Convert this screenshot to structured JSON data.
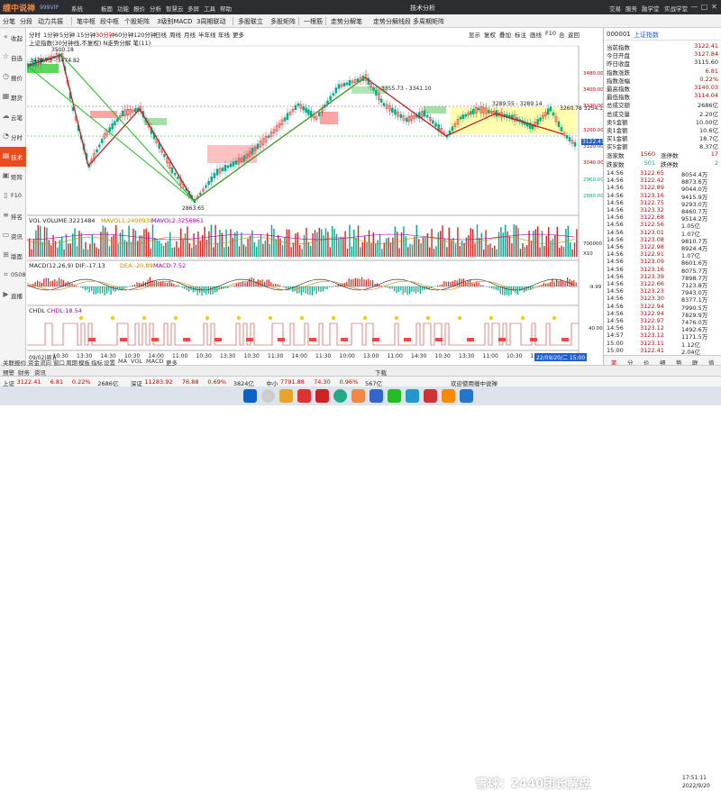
{
  "app": {
    "logo": "缠中说禅",
    "logo_sub": "999VIP",
    "menus": [
      "系统",
      "板面",
      "功能",
      "报价",
      "分析",
      "智慧云",
      "多屏",
      "工具",
      "帮助"
    ],
    "window_title": "技术分析",
    "right_links": [
      "交易",
      "服务",
      "融学堂",
      "实战学堂"
    ],
    "win_buttons": [
      "—",
      "□",
      "✕"
    ]
  },
  "toolbar": {
    "items": [
      "分笔",
      "分段",
      "动力共振",
      "笔中枢",
      "段中枢",
      "个股矩阵",
      "3级别MACD",
      "3周期联动",
      "多股联立",
      "多股矩阵",
      "一根筋",
      "走势分解笔",
      "走势分解线段",
      "多周期矩阵"
    ]
  },
  "sidebar": {
    "items": [
      {
        "label": "收起",
        "icon": "collapse-icon"
      },
      {
        "label": "自选",
        "icon": "star-icon"
      },
      {
        "label": "报价",
        "icon": "quote-icon"
      },
      {
        "label": "期货",
        "icon": "futures-icon"
      },
      {
        "label": "云笔",
        "icon": "cloud-icon"
      },
      {
        "label": "分时",
        "icon": "clock-icon"
      },
      {
        "label": "技术",
        "icon": "candle-icon"
      },
      {
        "label": "矩阵",
        "icon": "grid-icon"
      },
      {
        "label": "F10",
        "icon": "doc-icon"
      },
      {
        "label": "排名",
        "icon": "rank-icon"
      },
      {
        "label": "资讯",
        "icon": "news-icon"
      },
      {
        "label": "版面",
        "icon": "layout-icon"
      },
      {
        "label": "0508",
        "icon": "code-icon"
      },
      {
        "label": "直播",
        "icon": "live-icon"
      }
    ],
    "active_index": 6
  },
  "chart": {
    "periods": [
      "分时",
      "1分钟",
      "5分钟",
      "15分钟",
      "30分钟",
      "60分钟",
      "120分钟",
      "日线",
      "周线",
      "月线",
      "半年线",
      "年线",
      "更多"
    ],
    "active_period": "30分钟",
    "right_tools": [
      "显示",
      "复权",
      "叠加",
      "标注",
      "画线",
      "F10",
      "合",
      "返回"
    ],
    "header": "上证指数(30分钟线,不复权) N走势分解 笔(11)",
    "price_labels": [
      "3500.18",
      "3478.73 - 3474.82",
      "3355.73 - 3341.10",
      "3289.55 - 3289.14",
      "3260.78",
      "3254.1",
      "2863.65"
    ],
    "cur_price_tag": "3122.41",
    "y_ticks": [
      "3480.00",
      "3400.00",
      "3320.00",
      "3200.00",
      "3120.00",
      "3040.00",
      "2960.00",
      "2880.00"
    ],
    "volume_label": "VOL VOLUME:3221484",
    "vol_ma1": "MAVOL1:2400938",
    "vol_ma2": "MAVOL2:3256861",
    "vol_ticks": [
      "700000",
      "X10"
    ],
    "macd_label": "MACD(12,26,9) DIF:-17.13",
    "macd_dea": "DEA:-20.89",
    "macd_val": "MACD:7.52",
    "macd_tick": "-9.99",
    "chdl_label": "CHDL",
    "chdl_val": "CHDL:18.54",
    "chdl_tick": "40.00",
    "time_axis": [
      "09/02|周五",
      "10:30",
      "13:30",
      "14:30",
      "10:30",
      "14:00",
      "11:00",
      "10:30",
      "13:30",
      "10:30",
      "11:30",
      "14:00",
      "11:30",
      "10:00",
      "13:00",
      "11:00",
      "14:30",
      "10:30",
      "13:30",
      "11:00",
      "10:30",
      "13:30",
      "14:00"
    ],
    "time_cursor": "22/09/20/二 15:00"
  },
  "quote": {
    "code": "000001",
    "name": "上证指数",
    "rows": [
      {
        "label": "当前指数",
        "value": "3122.41",
        "color": "#c00"
      },
      {
        "label": "今日开盘",
        "value": "3127.84",
        "color": "#c00"
      },
      {
        "label": "昨日收盘",
        "value": "3115.60",
        "color": "#222"
      },
      {
        "label": "指数涨跌",
        "value": "6.81",
        "color": "#c00"
      },
      {
        "label": "指数涨幅",
        "value": "0.22%",
        "color": "#c00"
      },
      {
        "label": "最高指数",
        "value": "3140.03",
        "color": "#c00"
      },
      {
        "label": "最低指数",
        "value": "3114.04",
        "color": "#c00"
      },
      {
        "label": "总成交额",
        "value": "2686亿",
        "color": "#222"
      },
      {
        "label": "总成交量",
        "value": "2.20亿",
        "color": "#222"
      },
      {
        "label": "卖5金额",
        "value": "10.00亿",
        "color": "#222"
      },
      {
        "label": "卖1金额",
        "value": "10.6亿",
        "color": "#222"
      },
      {
        "label": "买1金额",
        "value": "18.7亿",
        "color": "#222"
      },
      {
        "label": "买5金额",
        "value": "8.37亿",
        "color": "#222"
      }
    ],
    "updown": {
      "up_label": "涨家数",
      "up": "1560",
      "flat_label": "涨停数",
      "flat": "17",
      "down_label": "跌家数",
      "down": "501",
      "limitdown_label": "跌停数",
      "limitdown": "2"
    }
  },
  "ticks": [
    [
      "14:56",
      "3122.65",
      "8054.4万",
      ""
    ],
    [
      "14:56",
      "3122.42",
      "8873.6万",
      ""
    ],
    [
      "14:56",
      "3122.89",
      "9044.0万",
      ""
    ],
    [
      "14:56",
      "3123.16",
      "9415.9万",
      ""
    ],
    [
      "14:56",
      "3122.75",
      "9293.0万",
      ""
    ],
    [
      "14:56",
      "3123.32",
      "8460.7万",
      ""
    ],
    [
      "14:56",
      "3122.68",
      "9514.2万",
      ""
    ],
    [
      "14:56",
      "3122.56",
      "1.05亿",
      ""
    ],
    [
      "14:56",
      "3123.01",
      "1.07亿",
      ""
    ],
    [
      "14:56",
      "3123.08",
      "9810.7万",
      ""
    ],
    [
      "14:56",
      "3122.98",
      "8924.4万",
      ""
    ],
    [
      "14:56",
      "3122.91",
      "1.07亿",
      ""
    ],
    [
      "14:56",
      "3123.09",
      "8601.6万",
      ""
    ],
    [
      "14:56",
      "3123.16",
      "8075.7万",
      ""
    ],
    [
      "14:56",
      "3123.39",
      "7898.7万",
      ""
    ],
    [
      "14:56",
      "3122.66",
      "7123.8万",
      ""
    ],
    [
      "14:56",
      "3123.23",
      "7943.0万",
      ""
    ],
    [
      "14:56",
      "3123.30",
      "8377.1万",
      ""
    ],
    [
      "14:56",
      "3122.94",
      "7990.5万",
      ""
    ],
    [
      "14:56",
      "3122.94",
      "7829.9万",
      ""
    ],
    [
      "14:56",
      "3122.97",
      "7476.0万",
      ""
    ],
    [
      "14:56",
      "3123.12",
      "1492.6万",
      ""
    ],
    [
      "14:57",
      "3123.12",
      "1171.5万",
      ""
    ],
    [
      "15:00",
      "3123.11",
      "1.12亿",
      ""
    ],
    [
      "15:00",
      "3122.41",
      "2.04亿",
      ""
    ]
  ],
  "right_tabs": [
    "笔",
    "分",
    "价",
    "细",
    "势",
    "联",
    "值"
  ],
  "bottom_bar": {
    "items": [
      "预警",
      "财务",
      "资讯",
      "关联报价",
      "资金流向",
      "窗口",
      "周期",
      "模板",
      "指标",
      "设置",
      "MA",
      "VOL",
      "MACD",
      "更多"
    ],
    "right": "下载"
  },
  "status_bar": {
    "items": [
      {
        "text": "上证",
        "color": "#222"
      },
      {
        "text": "3122.41",
        "color": "#c00"
      },
      {
        "text": "6.81",
        "color": "#c00"
      },
      {
        "text": "0.22%",
        "color": "#c00"
      },
      {
        "text": "2686亿",
        "color": "#222"
      },
      {
        "text": "深证",
        "color": "#222"
      },
      {
        "text": "11283.92",
        "color": "#c00"
      },
      {
        "text": "76.88",
        "color": "#c00"
      },
      {
        "text": "0.69%",
        "color": "#c00"
      },
      {
        "text": "3824亿",
        "color": "#222"
      },
      {
        "text": "中小",
        "color": "#222"
      },
      {
        "text": "7791.88",
        "color": "#c00"
      },
      {
        "text": "74.30",
        "color": "#c00"
      },
      {
        "text": "0.96%",
        "color": "#c00"
      },
      {
        "text": "567亿",
        "color": "#222"
      }
    ],
    "notice": "欢迎使用缠中说禅"
  },
  "taskbar": {
    "watermark": "雪球：2440团长解盘",
    "time": "17:51:11",
    "date": "2022/9/20"
  }
}
